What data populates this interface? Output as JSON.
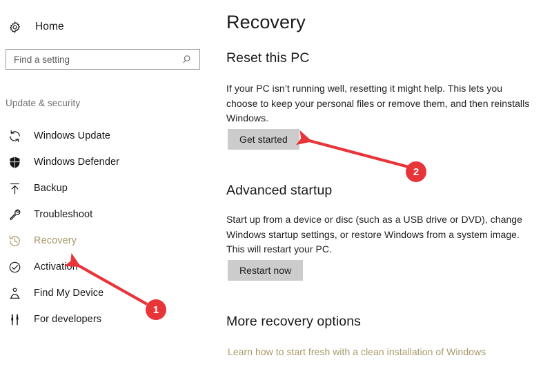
{
  "sidebar": {
    "home": {
      "label": "Home",
      "icon": "gear-icon"
    },
    "search": {
      "placeholder": "Find a setting",
      "icon": "search-icon"
    },
    "section_label": "Update & security",
    "items": [
      {
        "label": "Windows Update",
        "icon": "sync-icon",
        "selected": false
      },
      {
        "label": "Windows Defender",
        "icon": "shield-icon",
        "selected": false
      },
      {
        "label": "Backup",
        "icon": "upload-arrow-icon",
        "selected": false
      },
      {
        "label": "Troubleshoot",
        "icon": "wrench-icon",
        "selected": false
      },
      {
        "label": "Recovery",
        "icon": "clock-history-icon",
        "selected": true
      },
      {
        "label": "Activation",
        "icon": "check-circle-icon",
        "selected": false
      },
      {
        "label": "Find My Device",
        "icon": "person-locator-icon",
        "selected": false
      },
      {
        "label": "For developers",
        "icon": "developer-tools-icon",
        "selected": false
      }
    ]
  },
  "main": {
    "page_title": "Recovery",
    "reset_pc": {
      "heading": "Reset this PC",
      "body": "If your PC isn’t running well, resetting it might help. This lets you choose to keep your personal files or remove them, and then reinstalls Windows.",
      "button": "Get started"
    },
    "advanced_startup": {
      "heading": "Advanced startup",
      "body": "Start up from a device or disc (such as a USB drive or DVD), change Windows startup settings, or restore Windows from a system image. This will restart your PC.",
      "button": "Restart now"
    },
    "more_recovery": {
      "heading": "More recovery options",
      "link": "Learn how to start fresh with a clean installation of Windows"
    }
  },
  "annotations": {
    "color": "#e8353a",
    "badges": [
      {
        "label": "1",
        "target": "sidebar-item-recovery"
      },
      {
        "label": "2",
        "target": "get-started-button"
      }
    ]
  },
  "colors": {
    "accent_tan": "#a89968",
    "button_gray": "#cccccc",
    "annotation_red": "#e8353a"
  }
}
